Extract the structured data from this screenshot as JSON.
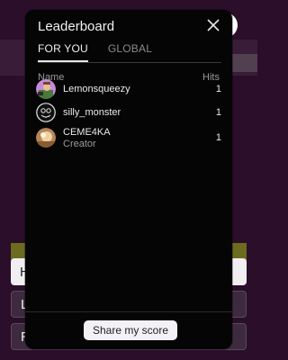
{
  "background": {
    "buttons": [
      {
        "label": "H"
      },
      {
        "label": "L"
      },
      {
        "label": "R"
      }
    ],
    "colors": {
      "page": "#2b0e2a",
      "green_bar": "#6c6b1f"
    }
  },
  "modal": {
    "title": "Leaderboard",
    "close_icon": "close-icon",
    "tabs": [
      {
        "label": "FOR YOU",
        "active": true
      },
      {
        "label": "GLOBAL",
        "active": false
      }
    ],
    "columns": {
      "name": "Name",
      "hits": "Hits"
    },
    "rows": [
      {
        "name": "Lemonsqueezy",
        "sub": "",
        "hits": "1",
        "avatar": "lemonsqueezy-avatar"
      },
      {
        "name": "silly_monster",
        "sub": "",
        "hits": "1",
        "avatar": "monster-avatar"
      },
      {
        "name": "CEME4KA",
        "sub": "Creator",
        "hits": "1",
        "avatar": "ceme4ka-avatar"
      }
    ],
    "share_label": "Share my score"
  }
}
